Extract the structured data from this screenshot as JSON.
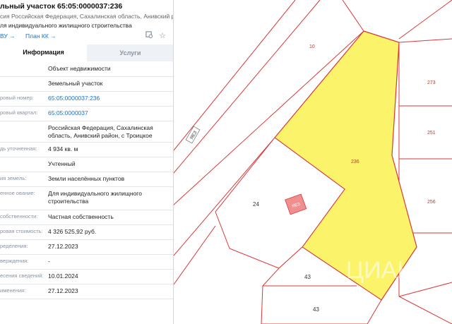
{
  "panel": {
    "title": "льный участок 65:05:0000037:236",
    "address": "сия Российская Федерация, Сахалинская область, Анивский район, с Троицкое",
    "purpose": "ля индивидуального жилищного строительства",
    "link_1": "ВУ →",
    "link_2": "План КК →",
    "tabs": [
      {
        "label": "Информация"
      },
      {
        "label": "Услуги"
      }
    ],
    "rows": [
      {
        "k": "",
        "v": "Объект недвижимости"
      },
      {
        "k": "",
        "v": "Земельный участок"
      },
      {
        "k": "ровый номер:",
        "v": "65:05:0000037:236"
      },
      {
        "k": "ровый квартал:",
        "v": "65:05:0000037"
      },
      {
        "k": "",
        "v": "Российская Федерация, Сахалинская область, Анивский район, с Троицкое"
      },
      {
        "k": "дь уточненная:",
        "v": "4 934 кв. м"
      },
      {
        "k": "",
        "v": "Учтенный"
      },
      {
        "k": "ия земель:",
        "v": "Земли населённых пунктов"
      },
      {
        "k": "енное ование:",
        "v": "Для индивидуального жилищного строительства"
      },
      {
        "k": "собственности:",
        "v": "Частная собственность"
      },
      {
        "k": "ровая стоимость:",
        "v": "4 326 525,92 руб."
      },
      {
        "k": "ределения:",
        "v": "27.12.2023"
      },
      {
        "k": "верждения:",
        "v": "-"
      },
      {
        "k": "есения сведений:",
        "v": "10.01.2024"
      },
      {
        "k": "именения:",
        "v": "27.12.2023"
      }
    ]
  },
  "map": {
    "labels": [
      "10",
      "273",
      "251",
      "236",
      "256",
      "24",
      "43",
      "43",
      "ЯЕЗ",
      "ЯЕЗ"
    ],
    "watermark": "ЦИАН"
  },
  "colors": {
    "highlight": "#fbf46a",
    "boundary": "#d9383a",
    "link": "#1a73c8"
  }
}
